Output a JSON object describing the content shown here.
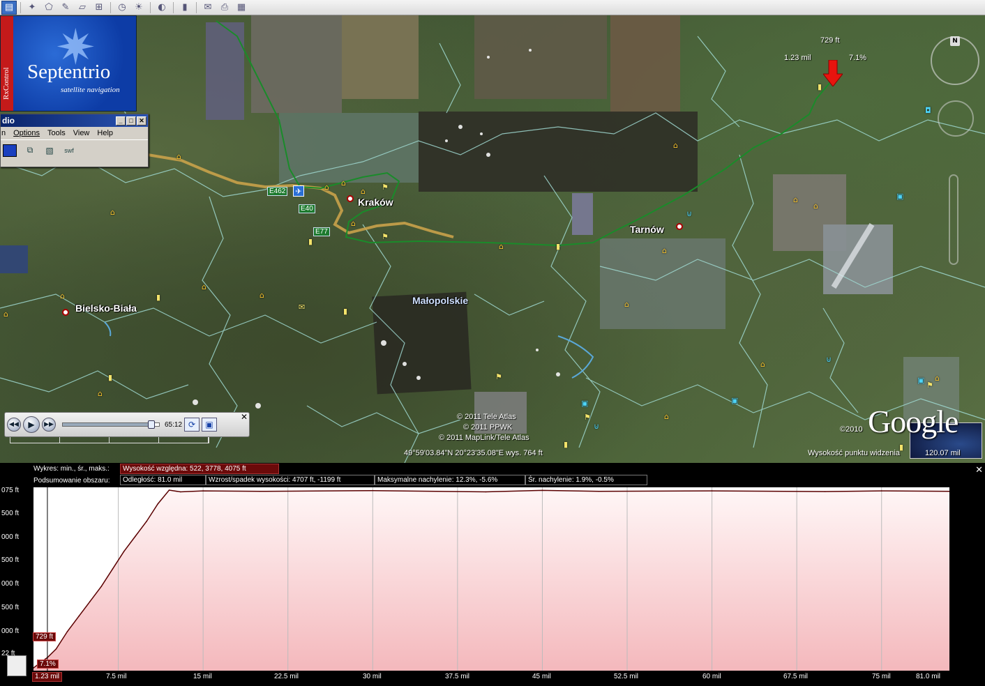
{
  "toolbar": {
    "buttons": [
      "sidebar-toggle",
      "placemark",
      "polygon",
      "path",
      "overlay",
      "tour",
      "sun",
      "planets",
      "ruler",
      "email",
      "print",
      "view-in-maps"
    ]
  },
  "logo": {
    "strip_text": "RxControl",
    "title": "Septentrio",
    "subtitle": "satellite navigation"
  },
  "studio_window": {
    "title": "dio",
    "menus": [
      "n",
      "Options",
      "Tools",
      "View",
      "Help"
    ]
  },
  "map": {
    "cities": [
      {
        "name": "Kraków"
      },
      {
        "name": "Tarnów"
      },
      {
        "name": "Bielsko-Biała"
      }
    ],
    "region": "Małopolskie",
    "road_shields": [
      "E462",
      "E40",
      "E77"
    ],
    "copyright": [
      "© 2011 Tele Atlas",
      "© 2011 PPWK",
      "© 2011 MapLink/Tele Atlas"
    ],
    "google_year": "©2010",
    "google_logo": "Google",
    "status": {
      "coords": "49°59'03.84\"N   20°23'35.08\"E  wys.   764 ft",
      "eye_alt_label": "Wysokość punktu widzenia",
      "eye_alt_value": "120.07 mil"
    },
    "marker": {
      "elev": "729 ft",
      "dist": "1.23 mil",
      "slope": "7.1%"
    }
  },
  "player": {
    "time": "65:12",
    "progress": 0.92
  },
  "profile": {
    "chart_label": "Wykres: min., śr., maks.:",
    "chart_value": "Wysokość względna: 522, 3778, 4075 ft",
    "summary_label": "Podsumowanie obszaru:",
    "distance": "Odległość: 81.0 mil",
    "gain_loss": "Wzrost/spadek wysokości: 4707 ft, -1199 ft",
    "max_slope": "Maksymalne nachylenie: 12.3%, -5.6%",
    "avg_slope": "Śr. nachylenie: 1.9%, -0.5%",
    "y_ticks": [
      "075 ft",
      "500 ft",
      "000 ft",
      "500 ft",
      "000 ft",
      "500 ft",
      "000 ft",
      "22 ft"
    ],
    "x_ticks": [
      "7.5 mil",
      "15 mil",
      "22.5 mil",
      "30 mil",
      "37.5 mil",
      "45 mil",
      "52.5 mil",
      "60 mil",
      "67.5 mil",
      "75 mil"
    ],
    "x_start": "1.23 mil",
    "x_end": "81.0 mil",
    "cursor_elev": "729 ft",
    "cursor_slope": "7.1%"
  },
  "chart_data": {
    "type": "area",
    "xlabel": "",
    "ylabel": "",
    "x_unit": "mil",
    "y_unit": "ft",
    "xlim": [
      0,
      81.0
    ],
    "ylim": [
      522,
      4075
    ],
    "x": [
      0,
      1.23,
      2,
      3,
      4,
      5,
      6,
      7,
      8,
      9,
      10,
      11,
      12,
      13,
      15,
      20,
      30,
      40,
      45,
      50,
      60,
      70,
      75,
      81
    ],
    "values": [
      522,
      729,
      900,
      1250,
      1550,
      1850,
      2150,
      2500,
      2850,
      3150,
      3450,
      3800,
      4075,
      4040,
      4060,
      4050,
      4065,
      4040,
      4070,
      4050,
      4060,
      4045,
      4060,
      4050
    ],
    "colors": {
      "fill": "#f4b8bc",
      "line": "#5a0000"
    }
  }
}
